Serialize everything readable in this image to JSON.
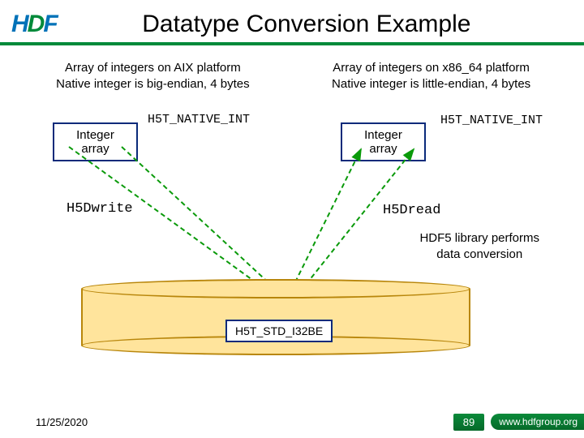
{
  "title": "Datatype Conversion Example",
  "left": {
    "desc_line1": "Array of integers on AIX platform",
    "desc_line2": "Native integer is big-endian, 4 bytes",
    "box_label": "Integer array",
    "native_type": "H5T_NATIVE_INT",
    "io_call": "H5Dwrite"
  },
  "right": {
    "desc_line1": "Array of integers on x86_64 platform",
    "desc_line2": "Native integer is little-endian, 4 bytes",
    "box_label": "Integer array",
    "native_type": "H5T_NATIVE_INT",
    "io_call": "H5Dread"
  },
  "conversion_note_line1": "HDF5 library performs",
  "conversion_note_line2": "data conversion",
  "disk_type": "H5T_STD_I32BE",
  "footer": {
    "date": "11/25/2020",
    "page": "89",
    "url": "www.hdfgroup.org"
  }
}
